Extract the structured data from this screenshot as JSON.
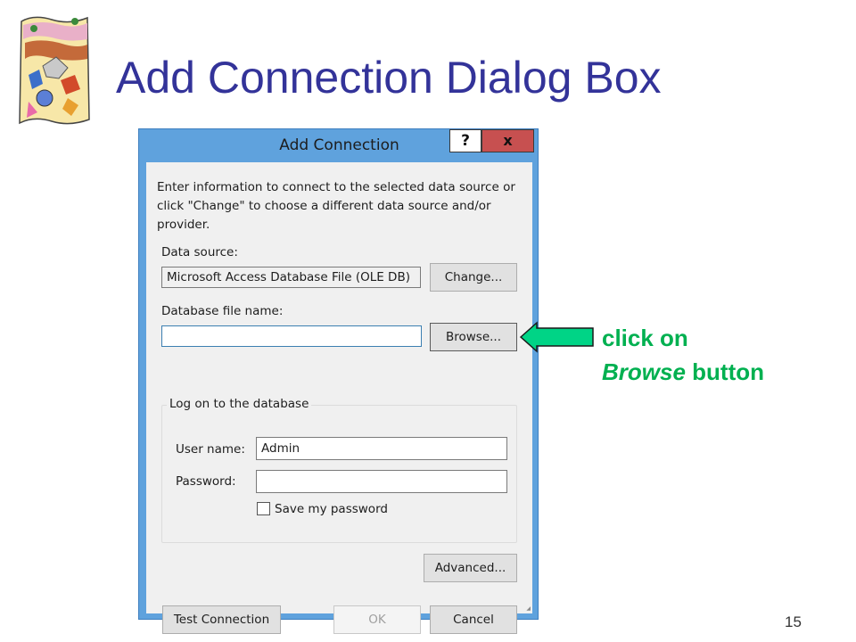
{
  "slide": {
    "title": "Add Connection Dialog Box",
    "page_number": "15",
    "logo_icon": "decorative-clipart-logo-icon"
  },
  "dialog": {
    "title": "Add Connection",
    "help_label": "?",
    "close_label": "x",
    "intro_text": "Enter information to connect to the selected data source or click \"Change\" to choose a different data source and/or provider.",
    "data_source_label": "Data source:",
    "data_source_value": "Microsoft Access Database File (OLE DB)",
    "change_label": "Change...",
    "db_file_label": "Database file name:",
    "db_file_value": "",
    "browse_label": "Browse...",
    "logon_group_label": "Log on to the database",
    "user_name_label": "User name:",
    "user_name_value": "Admin",
    "password_label": "Password:",
    "password_value": "",
    "save_password_label": "Save my password",
    "save_password_checked": false,
    "advanced_label": "Advanced...",
    "test_connection_label": "Test Connection",
    "ok_label": "OK",
    "cancel_label": "Cancel"
  },
  "annotation": {
    "line1": "click on",
    "line2_italic": "Browse",
    "line2_rest": " button",
    "color": "#00b050",
    "arrow_icon": "left-arrow-icon"
  },
  "colors": {
    "title": "#333399",
    "window_frame": "#5fa2dd",
    "close_button": "#c75050"
  }
}
